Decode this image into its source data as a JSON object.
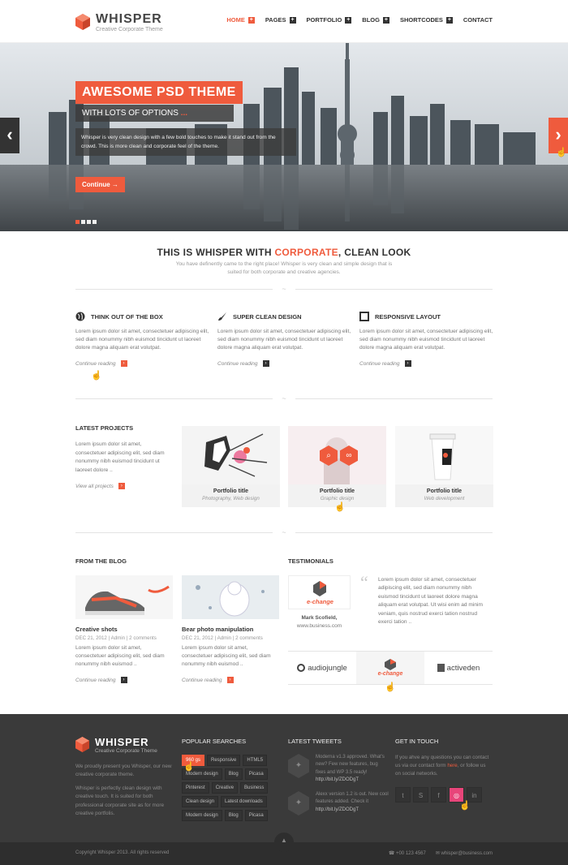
{
  "brand": {
    "name": "WHISPER",
    "tagline": "Creative  Corporate Theme",
    "accent": "#ef5b3d"
  },
  "nav": [
    {
      "label": "HOME",
      "active": true
    },
    {
      "label": "PAGES"
    },
    {
      "label": "PORTFOLIO"
    },
    {
      "label": "BLOG"
    },
    {
      "label": "SHORTCODES"
    },
    {
      "label": "CONTACT"
    }
  ],
  "hero": {
    "title": "AWESOME PSD THEME",
    "subtitle": "WITH LOTS OF OPTIONS",
    "subtitle_dots": "...",
    "description": "Whisper is very clean design with a few bold touches to make it stand out from the crowd. This is more clean and corporate feel of the theme.",
    "button": "Continue",
    "button_arrow": "→",
    "prev_icon": "‹",
    "next_icon": "›"
  },
  "intro": {
    "title_prefix": "THIS IS WHISPER WITH",
    "title_highlight": "CORPORATE",
    "title_suffix": ", CLEAN LOOK",
    "text": "You have definently came to the right place! Whisper is very clean and simple design that is suited for both corporate and creative agencies."
  },
  "features": [
    {
      "title": "THINK OUT OF THE BOX",
      "icon": "globe-icon",
      "text": "Lorem ipsum dolor sit amet, consectetuer adipiscing elit, sed diam nonummy nibh euismod tincidunt ut laoreet dolore magna aliquam erat volutpat.",
      "link": "Continue reading"
    },
    {
      "title": "SUPER CLEAN DESIGN",
      "icon": "brush-icon",
      "text": "Lorem ipsum dolor sit amet, consectetuer adipiscing elit, sed diam nonummy nibh euismod tincidunt ut laoreet dolore magna aliquam erat volutpat.",
      "link": "Continue reading"
    },
    {
      "title": "RESPONSIVE LAYOUT",
      "icon": "square-icon",
      "text": "Lorem ipsum dolor sit amet, consectetuer adipiscing elit, sed diam nonummy nibh euismod tincidunt ut laoreet dolore magna aliquam erat volutpat.",
      "link": "Continue reading"
    }
  ],
  "projects": {
    "title": "LATEST PROJECTS",
    "text": "Lorem ipsum dolor sit amet, consectetuer adipiscing elit, sed diam nonummy nibh euismod tincidunt ut laoreet dolore ..",
    "link": "View all projects",
    "items": [
      {
        "title": "Portfolio title",
        "category": "Photography, Web design"
      },
      {
        "title": "Portfolio title",
        "category": "Graphic design"
      },
      {
        "title": "Portfolio title",
        "category": "Web development"
      }
    ]
  },
  "blog": {
    "title": "FROM THE BLOG",
    "posts": [
      {
        "title": "Creative shots",
        "meta": "DEC 21, 2012 | Admin | 2 comments",
        "text": "Lorem ipsum dolor sit amet, consectetuer adipiscing elit, sed diam nonummy nibh euismod ..",
        "link": "Continue reading"
      },
      {
        "title": "Bear photo manipulation",
        "meta": "DEC 21, 2012 | Admin | 2 comments",
        "text": "Lorem ipsum dolor sit amet, consectetuer adipiscing elit, sed diam nonummy nibh euismod ..",
        "link": "Continue reading"
      }
    ]
  },
  "testimonials": {
    "title": "TESTIMONIALS",
    "logo": "e-change",
    "name": "Mark Scofield,",
    "url": "www.business.com",
    "quote_mark": "“",
    "text": "Lorem ipsum dolor sit amet, consectetuer adipiscing elit, sed diam nonummy nibh euismod tincidunt ut laoreet dolore magna aliquam erat volutpat. Ut wisi enim ad minim veniam, quis nostrud exerci tation nostrud exerci tation ..",
    "clients": [
      "audiojungle",
      "e-change",
      "activeden"
    ]
  },
  "footer": {
    "name": "WHISPER",
    "tagline": "Creative  Corporate Theme",
    "text1": "We proudly present you Whisper, our new creative corporate theme.",
    "text2": "Whisper is perfectly clean design with creative touch. It is suited for both professional corporate site as for more creative portfolis.",
    "searches_title": "POPULAR SEARCHES",
    "tags": [
      "960 gs",
      "Responsive",
      "HTML5",
      "Modern design",
      "Blog",
      "Picasa",
      "Pinterest",
      "Creative",
      "Business",
      "Clean design",
      "Latest downloads",
      "Modern design",
      "Blog",
      "Picasa"
    ],
    "tweets_title": "LATEST TWEEETS",
    "tweets": [
      {
        "text": "Moderna v1.3 approved. What's new? Few new features, bug fixes and WP 3.5 ready!",
        "link": "http://bit.ly/ZDODgT"
      },
      {
        "text": "Alexx version 1.2 is out. New cool features added. Check it",
        "link": "http://bit.ly/ZDODgT"
      }
    ],
    "contact_title": "GET IN TOUCH",
    "contact_pre": "If you ahve any questions you can contact us via our contact form",
    "contact_here": "here",
    "contact_post": ", or follow us on social networks.",
    "socials": [
      "twitter-icon",
      "skype-icon",
      "facebook-icon",
      "dribbble-icon",
      "linkedin-icon"
    ],
    "copyright": "Copyright Whisper 2013. All rights reserved",
    "phone": "+00 123 4567",
    "email": "whisper@business.com"
  }
}
